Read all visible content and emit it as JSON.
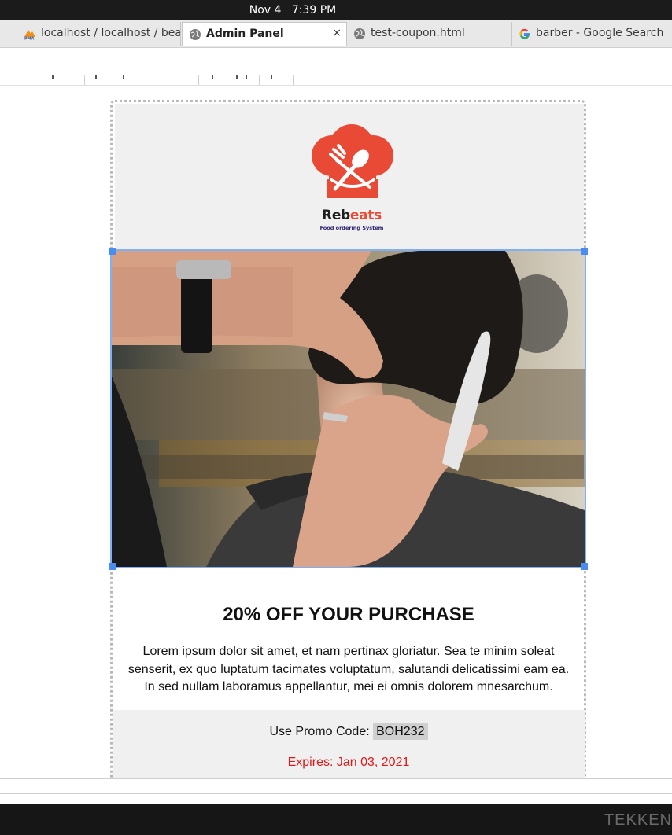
{
  "system": {
    "date": "Nov 4",
    "time": "7:39 PM"
  },
  "tabs": [
    {
      "label": "localhost / localhost / bea",
      "icon": "phpmyadmin-icon",
      "active": false
    },
    {
      "label": "Admin Panel",
      "icon": "globe-icon",
      "active": true,
      "close": "×"
    },
    {
      "label": "test-coupon.html",
      "icon": "globe-icon",
      "active": false
    },
    {
      "label": "barber - Google Search",
      "icon": "google-icon",
      "active": false
    }
  ],
  "email": {
    "brand_prefix": "Reb",
    "brand_suffix": "eats",
    "tagline": "Food ordering System",
    "hero_image": "barber-photo",
    "title": "20% OFF YOUR PURCHASE",
    "body": "Lorem ipsum dolor sit amet, et nam pertinax gloriatur. Sea te minim soleat senserit, ex quo luptatum tacimates voluptatum, salutandi delicatissimi eam ea. In sed nullam laboramus appellantur, mei ei omnis dolorem mnesarchum.",
    "promo_label": "Use Promo Code:",
    "promo_code": "BOH232",
    "expires": "Expires: Jan 03, 2021"
  },
  "background_text": "TEKKEN",
  "colors": {
    "brand": "#e94a35",
    "tagline": "#2a1f6e",
    "expires": "#e01818",
    "selection": "#4a8df0"
  }
}
